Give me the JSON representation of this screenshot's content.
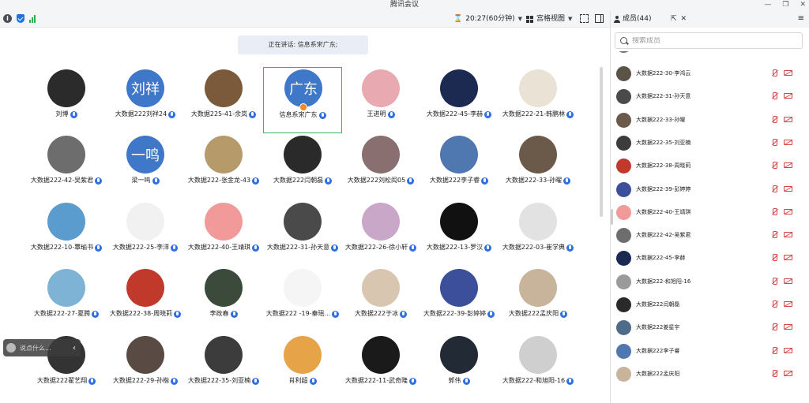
{
  "window": {
    "title": "腾讯会议"
  },
  "toolbar": {
    "timer": "20:27(60分钟)",
    "view_label": "宫格视图"
  },
  "speaking": "正在讲话: 信息系宋广东;",
  "chat": {
    "placeholder": "说点什么..."
  },
  "grid": [
    {
      "name": "刘博",
      "avatar_text": "",
      "color": "#2b2b2b"
    },
    {
      "name": "大数据222刘祥24",
      "avatar_text": "刘祥",
      "color": "#3f77c9"
    },
    {
      "name": "大数据225-41-余岚",
      "avatar_text": "",
      "color": "#7a5a3a"
    },
    {
      "name": "信息系宋广东",
      "avatar_text": "广东",
      "color": "#3f77c9",
      "active": true
    },
    {
      "name": "王进明",
      "avatar_text": "",
      "color": "#e8a9b0"
    },
    {
      "name": "大数据222-45-李赫",
      "avatar_text": "",
      "color": "#1c2a52"
    },
    {
      "name": "大数据222-21-韩鹏林",
      "avatar_text": "",
      "color": "#e9e2d5"
    },
    {
      "name": "大数据222-42-吴紫君",
      "avatar_text": "",
      "color": "#6d6d6d"
    },
    {
      "name": "梁一鸣",
      "avatar_text": "一鸣",
      "color": "#3f77c9"
    },
    {
      "name": "大数据222-张金龙-43",
      "avatar_text": "",
      "color": "#b79a6a"
    },
    {
      "name": "大数据222闫朝磊",
      "avatar_text": "",
      "color": "#2a2a2a"
    },
    {
      "name": "大数据222刘松闳05",
      "avatar_text": "",
      "color": "#8a6f70"
    },
    {
      "name": "大数据222李子睿",
      "avatar_text": "",
      "color": "#4f78b0"
    },
    {
      "name": "大数据222-33-孙曜",
      "avatar_text": "",
      "color": "#6b5a4a"
    },
    {
      "name": "大数据222-10-覃瑜书",
      "avatar_text": "",
      "color": "#5b9ccf"
    },
    {
      "name": "大数据222-25-李洋",
      "avatar_text": "",
      "color": "#f1f1f1"
    },
    {
      "name": "大数据222-40-王靖琪",
      "avatar_text": "",
      "color": "#f29a9a"
    },
    {
      "name": "大数据222-31-孙天意",
      "avatar_text": "",
      "color": "#4a4a4a"
    },
    {
      "name": "大数据222-26-徐小轩",
      "avatar_text": "",
      "color": "#c9a7c9"
    },
    {
      "name": "大数据222-13-罗汉",
      "avatar_text": "",
      "color": "#111111"
    },
    {
      "name": "大数据222-03-崔学典",
      "avatar_text": "",
      "color": "#e2e2e2"
    },
    {
      "name": "大数据222-27-夏腾",
      "avatar_text": "",
      "color": "#7fb3d6"
    },
    {
      "name": "大数据222-38-周晓莉",
      "avatar_text": "",
      "color": "#c0392b"
    },
    {
      "name": "李政春",
      "avatar_text": "",
      "color": "#3b4a3b"
    },
    {
      "name": "大数据222 -19-秦瑶...",
      "avatar_text": "",
      "color": "#f5f5f5"
    },
    {
      "name": "大数据222于冰",
      "avatar_text": "",
      "color": "#d9c6b0"
    },
    {
      "name": "大数据222-39-彭婷婷",
      "avatar_text": "",
      "color": "#3b4f9a"
    },
    {
      "name": "大数据222孟庆阳",
      "avatar_text": "",
      "color": "#c7b49a"
    },
    {
      "name": "大数据222翟艺翔",
      "avatar_text": "",
      "color": "#333333"
    },
    {
      "name": "大数据222-29-孙楷",
      "avatar_text": "",
      "color": "#5a4a44"
    },
    {
      "name": "大数据222-35-刘亚楠",
      "avatar_text": "",
      "color": "#3c3c3c"
    },
    {
      "name": "肖利超",
      "avatar_text": "",
      "color": "#e7a347"
    },
    {
      "name": "大数据222-11-武奇隆",
      "avatar_text": "",
      "color": "#1a1a1a"
    },
    {
      "name": "郭伟",
      "avatar_text": "",
      "color": "#222a35"
    },
    {
      "name": "大数据222-和旭阳-16",
      "avatar_text": "",
      "color": "#cfcfcf"
    }
  ],
  "sidebar": {
    "members_label": "成员(44)",
    "search_placeholder": "搜索成员",
    "members": [
      {
        "name": "大数据222-30-李鸿云",
        "color": "#5a5346"
      },
      {
        "name": "大数据222-31-孙天意",
        "color": "#4a4a4a"
      },
      {
        "name": "大数据222-33-孙曜",
        "color": "#6b5a4a"
      },
      {
        "name": "大数据222-35-刘亚楠",
        "color": "#3c3c3c"
      },
      {
        "name": "大数据222-38-周晓莉",
        "color": "#c0392b"
      },
      {
        "name": "大数据222-39-彭婷婷",
        "color": "#3b4f9a"
      },
      {
        "name": "大数据222-40-王靖琪",
        "color": "#f29a9a"
      },
      {
        "name": "大数据222-42-吴紫君",
        "color": "#6d6d6d"
      },
      {
        "name": "大数据222-45-李赫",
        "color": "#1c2a52"
      },
      {
        "name": "大数据222-和旭阳-16",
        "color": "#9a9a9a"
      },
      {
        "name": "大数据222闫朝磊",
        "color": "#2a2a2a"
      },
      {
        "name": "大数据222姜星宇",
        "color": "#4f6b8a"
      },
      {
        "name": "大数据222李子睿",
        "color": "#4f78b0"
      },
      {
        "name": "大数据222孟庆阳",
        "color": "#c7b49a"
      }
    ]
  }
}
